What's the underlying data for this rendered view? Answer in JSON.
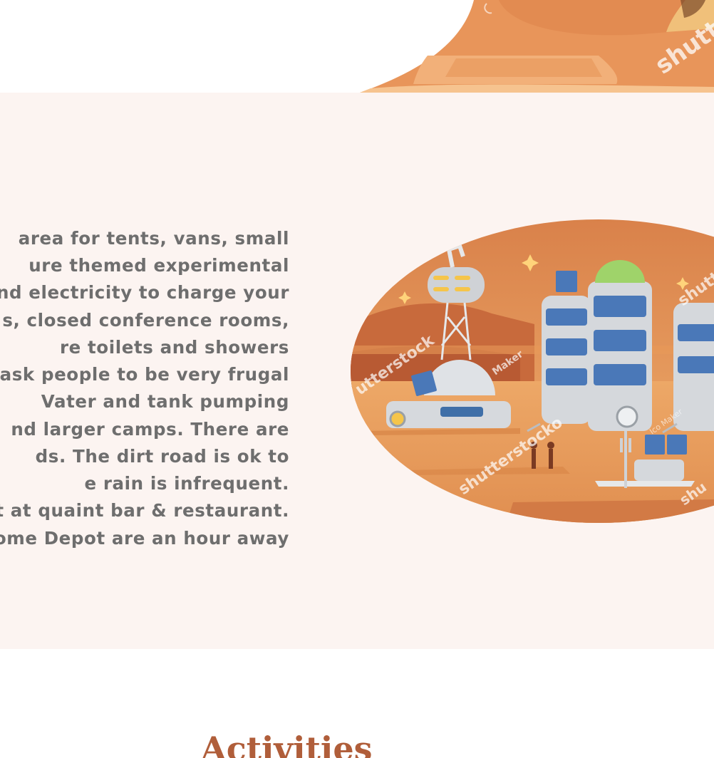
{
  "hero": {
    "illustration": "mars-desert-landscape-illustration",
    "watermark": "shutt",
    "colors": {
      "sand": "#e8955a",
      "sand_light": "#f4b77a",
      "sand_dark": "#d27a45"
    }
  },
  "intro": {
    "background": "#fcf4f1",
    "text_color": "#6e6e6e",
    "lines": [
      "area for tents, vans, small",
      "ure themed experimental",
      "and electricity to charge your",
      "s, closed conference rooms,",
      "re toilets and showers",
      "e ask people to be very frugal",
      "Vater and tank pumping",
      "nd larger camps. There are",
      "ds. The dirt road is ok to",
      "e rain is infrequent.",
      "et at quaint bar & restaurant.",
      "ome Depot are an hour away"
    ]
  },
  "colony_image": {
    "illustration": "mars-colony-illustration",
    "watermarks": [
      "utterstock",
      "shutterstocko",
      "Maker",
      "shutt",
      "shu",
      "Ico Maker"
    ]
  },
  "activities": {
    "title": "Activities",
    "title_color": "#b05e3a"
  }
}
